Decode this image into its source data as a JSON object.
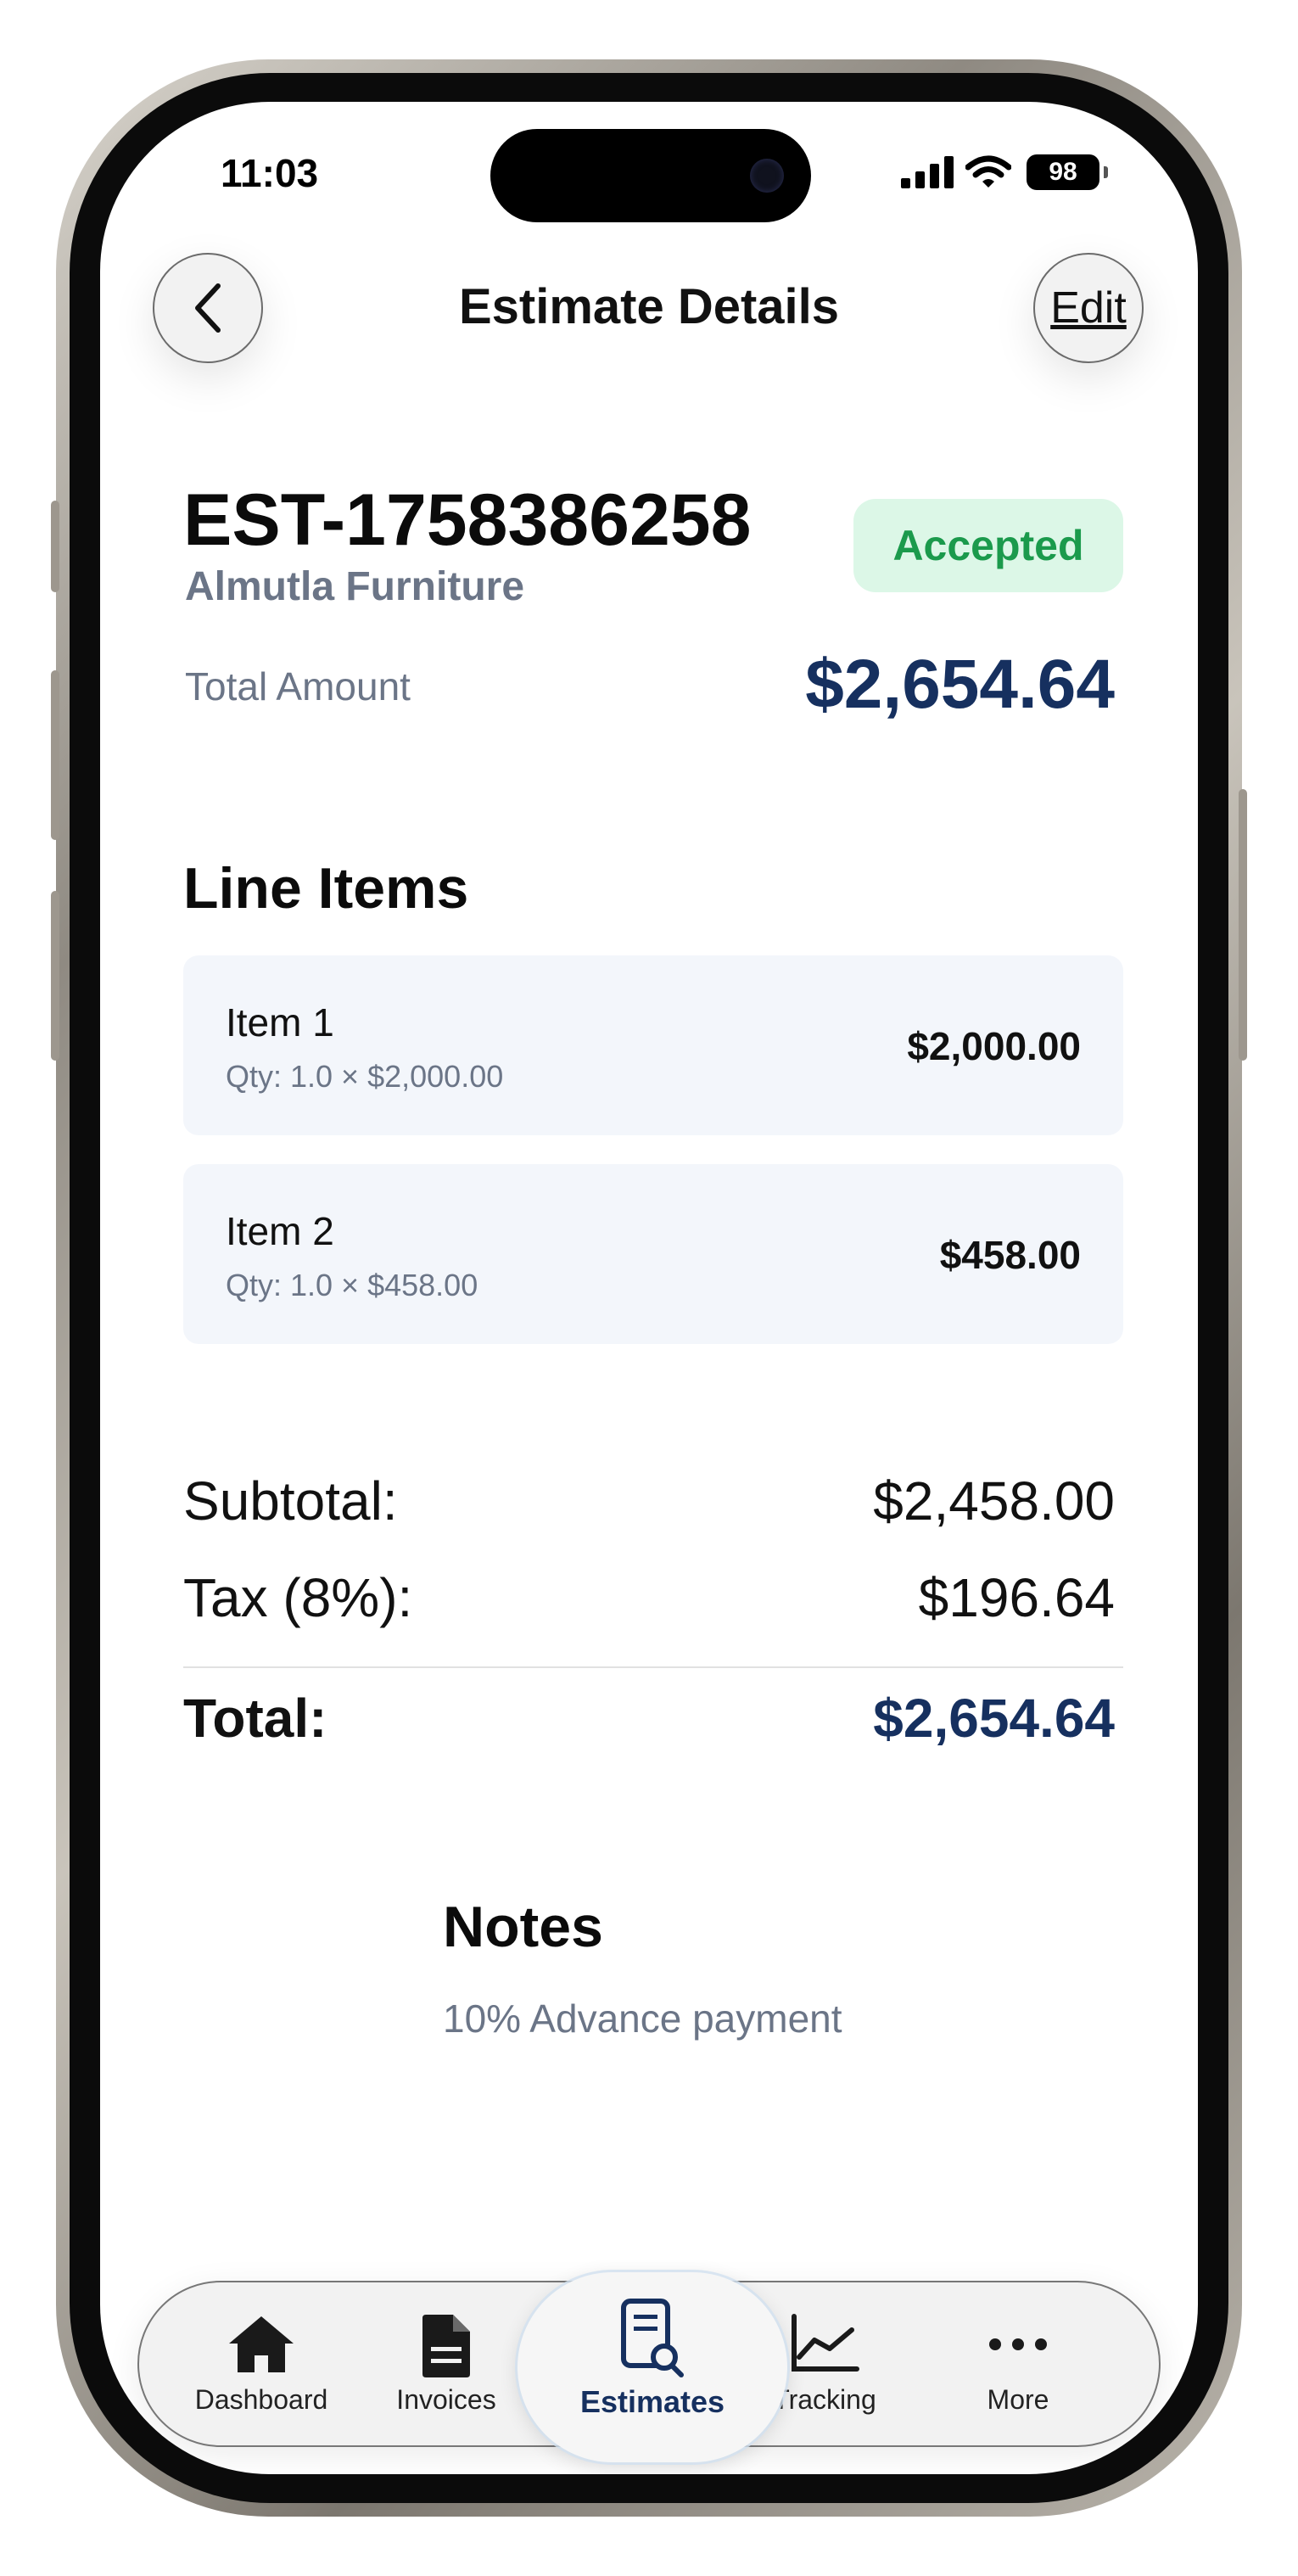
{
  "status_bar": {
    "time": "11:03",
    "battery": "98"
  },
  "nav": {
    "title": "Estimate Details",
    "edit_label": "Edit"
  },
  "estimate": {
    "number": "EST-1758386258",
    "client": "Almutla Furniture",
    "status": "Accepted",
    "total_label": "Total Amount",
    "total_amount": "$2,654.64"
  },
  "line_items": {
    "title": "Line Items",
    "items": [
      {
        "name": "Item 1",
        "qty": "Qty: 1.0 × $2,000.00",
        "amount": "$2,000.00"
      },
      {
        "name": "Item 2",
        "qty": "Qty: 1.0 × $458.00",
        "amount": "$458.00"
      }
    ]
  },
  "summary": {
    "subtotal_label": "Subtotal:",
    "subtotal_value": "$2,458.00",
    "tax_label": "Tax (8%):",
    "tax_value": "$196.64",
    "total_label": "Total:",
    "total_value": "$2,654.64"
  },
  "notes": {
    "title": "Notes",
    "text": "10% Advance payment"
  },
  "tabs": [
    {
      "label": "Dashboard",
      "icon": "house-icon"
    },
    {
      "label": "Invoices",
      "icon": "document-icon"
    },
    {
      "label": "Estimates",
      "icon": "estimate-search-icon",
      "active": true
    },
    {
      "label": "Tracking",
      "icon": "line-chart-icon"
    },
    {
      "label": "More",
      "icon": "ellipsis-icon"
    }
  ],
  "colors": {
    "accent_navy": "#16305f",
    "status_green": "#1b9a4c",
    "badge_bg": "#dcf7e7",
    "card_bg": "#f3f6fb",
    "muted_text": "#6b7587"
  }
}
